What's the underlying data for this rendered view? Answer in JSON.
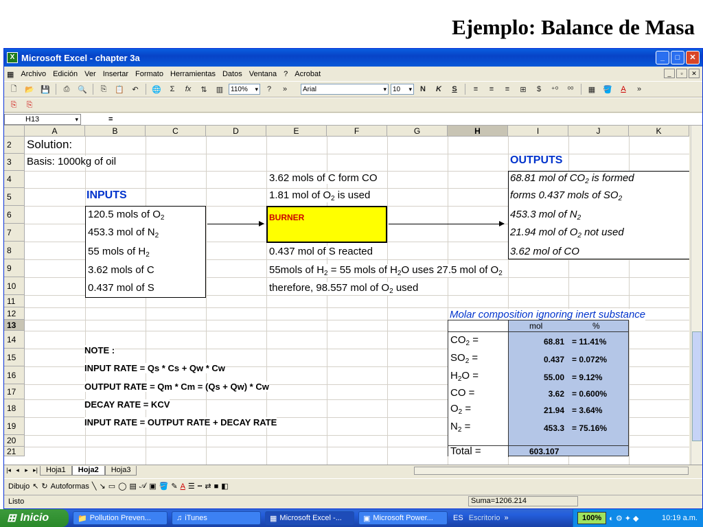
{
  "slide": {
    "title": "Ejemplo: Balance de Masa"
  },
  "window": {
    "title": "Microsoft Excel - chapter 3a"
  },
  "menu": [
    "Archivo",
    "Edición",
    "Ver",
    "Insertar",
    "Formato",
    "Herramientas",
    "Datos",
    "Ventana",
    "?",
    "Acrobat"
  ],
  "toolbar": {
    "zoom": "110%",
    "font": "Arial",
    "size": "10",
    "buttons": [
      "N",
      "K",
      "S"
    ]
  },
  "formula_bar": {
    "name_box": "H13",
    "equals": "="
  },
  "columns": [
    "A",
    "B",
    "C",
    "D",
    "E",
    "F",
    "G",
    "H",
    "I",
    "J",
    "K"
  ],
  "selected_column": "H",
  "rows": [
    "2",
    "3",
    "4",
    "5",
    "6",
    "7",
    "8",
    "9",
    "10",
    "11",
    "12",
    "13",
    "14",
    "15",
    "16",
    "17",
    "18",
    "19",
    "20",
    "21"
  ],
  "cells": {
    "solution": "Solution:",
    "basis": "Basis: 1000kg of oil",
    "inputs_title": "INPUTS",
    "outputs_title": "OUTPUTS",
    "in1": "120.5 mols of O",
    "in2": "453.3 mol of N",
    "in3": "55 mols of H",
    "in4": "3.62 mols of C",
    "in5": "0.437 mol of S",
    "mid1": "3.62 mols of C form CO",
    "mid2a": "1.81 mol of O",
    "mid2b": " is used",
    "burner": "BURNER",
    "mid3": "0.437 mol of S reacted",
    "mid4a": "55mols of H",
    "mid4b": " = 55 mols of H",
    "mid4c": "O uses 27.5 mol of O",
    "mid5a": "therefore, 98.557 mol of O",
    "mid5b": " used",
    "out1a": "68.81 mol of CO",
    "out1b": "  is formed",
    "out2a": " forms 0.437 mols of SO",
    "out3": "453.3 mol of N",
    "out4a": "21.94 mol of O",
    "out4b": "  not used",
    "out5": "3.62 mol of CO",
    "sub2": "2"
  },
  "notes": [
    "NOTE :",
    "INPUT RATE = Qs * Cs + Qw * Cw",
    "OUTPUT RATE = Qm * Cm = (Qs + Qw) * Cw",
    "DECAY RATE = KCV",
    "INPUT RATE = OUTPUT RATE + DECAY RATE"
  ],
  "molar": {
    "title": "Molar composition ignoring inert substance",
    "headers": [
      "mol",
      "%"
    ],
    "rows": [
      {
        "name": "CO",
        "sub": "2",
        "mol": "68.81",
        "pct": "= 11.41%"
      },
      {
        "name": "SO",
        "sub": "2",
        "mol": "0.437",
        "pct": "= 0.072%"
      },
      {
        "name": "H",
        "sub": "2",
        "name2": "O",
        "mol": "55.00",
        "pct": "= 9.12%"
      },
      {
        "name": "CO",
        "sub": "",
        "mol": "3.62",
        "pct": "= 0.600%"
      },
      {
        "name": "O",
        "sub": "2",
        "mol": "21.94",
        "pct": "= 3.64%"
      },
      {
        "name": "N",
        "sub": "2",
        "mol": "453.3",
        "pct": "= 75.16%"
      },
      {
        "name": "Total",
        "sub": "",
        "mol": "603.107",
        "pct": ""
      }
    ]
  },
  "sheets": [
    "Hoja1",
    "Hoja2",
    "Hoja3"
  ],
  "active_sheet": "Hoja2",
  "drawbar": {
    "dibujo": "Dibujo",
    "autoformas": "Autoformas"
  },
  "status": {
    "ready": "Listo",
    "sum": "Suma=1206.214"
  },
  "taskbar": {
    "start": "Inicio",
    "tasks": [
      "Pollution Preven...",
      "iTunes",
      "Microsoft Excel -...",
      "Microsoft Power..."
    ],
    "lang": "ES",
    "desktop": "Escritorio",
    "zoom": "100%",
    "time": "10:19 a.m."
  }
}
